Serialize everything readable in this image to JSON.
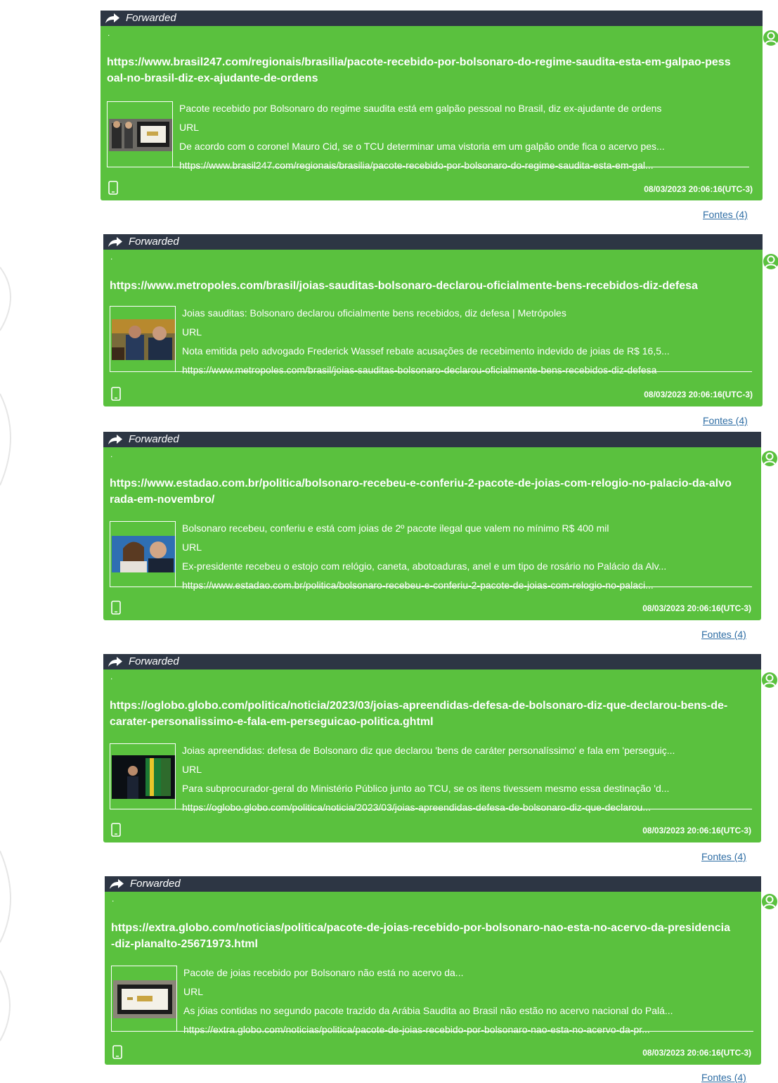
{
  "messages": [
    {
      "forwarded_label": "Forwarded",
      "dot": ".",
      "link": "https://www.brasil247.com/regionais/brasilia/pacote-recebido-por-bolsonaro-do-regime-saudita-esta-em-galpao-pessoal-no-brasil-diz-ex-ajudante-de-ordens",
      "preview_title": "Pacote recebido por Bolsonaro do regime saudita está em galpão pessoal no Brasil, diz ex-ajudante de ordens",
      "preview_type": "URL",
      "preview_description": "De acordo com o coronel Mauro Cid, se o TCU determinar uma vistoria em um galpão onde fica o acervo pes...",
      "preview_url": "https://www.brasil247.com/regionais/brasilia/pacote-recebido-por-bolsonaro-do-regime-saudita-esta-em-gal...",
      "timestamp": "08/03/2023 20:06:16(UTC-3)",
      "sources": "Fontes (4)"
    },
    {
      "forwarded_label": "Forwarded",
      "dot": ".",
      "link": "https://www.metropoles.com/brasil/joias-sauditas-bolsonaro-declarou-oficialmente-bens-recebidos-diz-defesa",
      "preview_title": "Joias sauditas: Bolsonaro declarou oficialmente bens recebidos, diz defesa | Metrópoles",
      "preview_type": "URL",
      "preview_description": "Nota emitida pelo advogado Frederick Wassef rebate acusações de recebimento indevido de joias de R$ 16,5...",
      "preview_url": "https://www.metropoles.com/brasil/joias-sauditas-bolsonaro-declarou-oficialmente-bens-recebidos-diz-defesa",
      "timestamp": "08/03/2023 20:06:16(UTC-3)",
      "sources": "Fontes (4)"
    },
    {
      "forwarded_label": "Forwarded",
      "dot": ".",
      "link": "https://www.estadao.com.br/politica/bolsonaro-recebeu-e-conferiu-2-pacote-de-joias-com-relogio-no-palacio-da-alvorada-em-novembro/",
      "preview_title": "Bolsonaro recebeu, conferiu e está com joias de 2º pacote ilegal que valem no mínimo R$ 400 mil",
      "preview_type": "URL",
      "preview_description": "Ex-presidente recebeu o estojo com relógio, caneta, abotoaduras, anel e um tipo de rosário no Palácio da Alv...",
      "preview_url": "https://www.estadao.com.br/politica/bolsonaro-recebeu-e-conferiu-2-pacote-de-joias-com-relogio-no-palaci...",
      "timestamp": "08/03/2023 20:06:16(UTC-3)",
      "sources": "Fontes (4)"
    },
    {
      "forwarded_label": "Forwarded",
      "dot": ".",
      "link": "https://oglobo.globo.com/politica/noticia/2023/03/joias-apreendidas-defesa-de-bolsonaro-diz-que-declarou-bens-de-carater-personalissimo-e-fala-em-perseguicao-politica.ghtml",
      "preview_title": "Joias apreendidas: defesa de Bolsonaro diz que declarou 'bens de caráter personalíssimo' e fala em 'perseguiç...",
      "preview_type": "URL",
      "preview_description": "Para subprocurador-geral do Ministério Público junto ao TCU, se os itens tivessem mesmo essa destinação 'd...",
      "preview_url": "https://oglobo.globo.com/politica/noticia/2023/03/joias-apreendidas-defesa-de-bolsonaro-diz-que-declarou...",
      "timestamp": "08/03/2023 20:06:16(UTC-3)",
      "sources": "Fontes (4)"
    },
    {
      "forwarded_label": "Forwarded",
      "dot": ".",
      "link": "https://extra.globo.com/noticias/politica/pacote-de-joias-recebido-por-bolsonaro-nao-esta-no-acervo-da-presidencia-diz-planalto-25671973.html",
      "preview_title": "Pacote de joias recebido por Bolsonaro não está no acervo da...",
      "preview_type": "URL",
      "preview_description": "As jóias contidas no segundo pacote trazido da Arábia Saudita ao Brasil não estão no acervo nacional do Palá...",
      "preview_url": "https://extra.globo.com/noticias/politica/pacote-de-joias-recebido-por-bolsonaro-nao-esta-no-acervo-da-pr...",
      "timestamp": "08/03/2023 20:06:16(UTC-3)",
      "sources": "Fontes (4)"
    }
  ],
  "colors": {
    "bubble": "#5ac13e",
    "forward_bar": "#2d3644",
    "link": "#2e6da4",
    "avatar": "#5ac13e"
  },
  "icons": {
    "forward": "forward-arrow-icon",
    "device": "mobile-device-icon",
    "avatar": "user-avatar-icon"
  }
}
